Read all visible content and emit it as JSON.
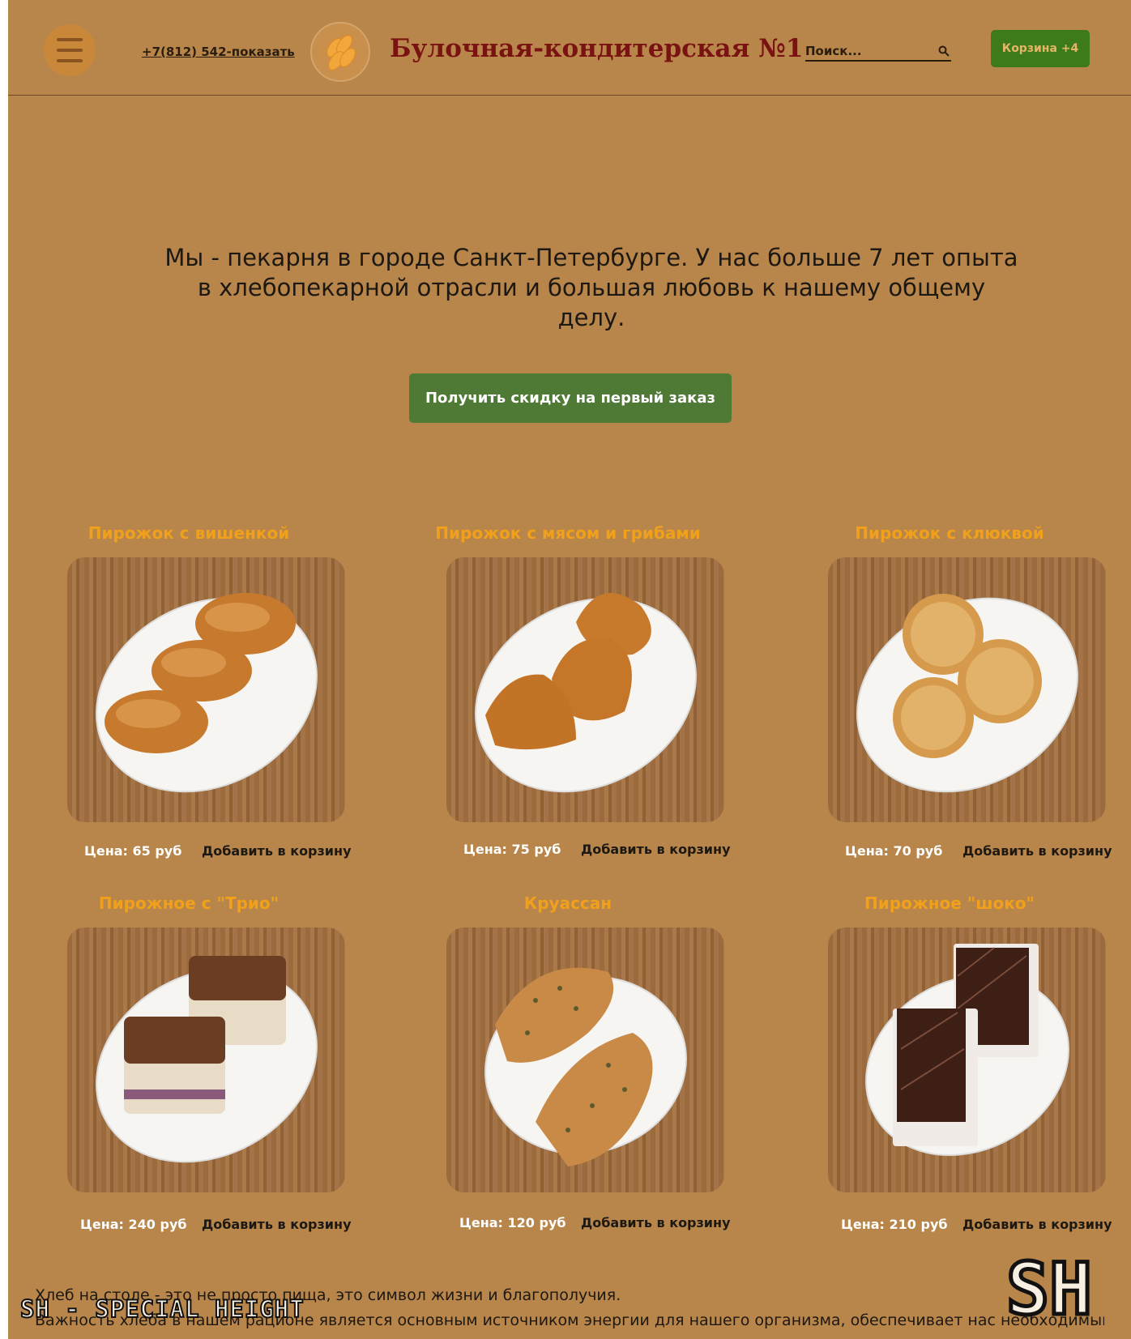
{
  "header": {
    "menu_icon": "hamburger-icon",
    "phone": "+7(812) 542-показать",
    "logo_icon": "wheat-logo",
    "title": "Булочная-кондитерская №1",
    "search_placeholder": "Поиск...",
    "search_icon": "search-icon",
    "cart_label": "Корзина +4"
  },
  "hero": {
    "line1": "Мы - пекарня в городе Санкт-Петербурге.  У нас больше 7 лет опыта",
    "line2": "в хлебопекарной отрасли и большая любовь к нашему общему",
    "line3": "делу.",
    "cta_label": "Получить скидку на первый заказ"
  },
  "products": [
    {
      "name": "Пирожок с  вишенкой",
      "price": "Цена: 65 руб",
      "add_label": "Добавить в корзину"
    },
    {
      "name": "Пирожок с мясом и грибами",
      "price": "Цена: 75 руб",
      "add_label": "Добавить в корзину"
    },
    {
      "name": "Пирожок с клюквой",
      "price": "Цена: 70 руб",
      "add_label": "Добавить в корзину"
    },
    {
      "name": "Пирожное с \"Трио\"",
      "price": "Цена: 240 руб",
      "add_label": "Добавить в корзину"
    },
    {
      "name": "Круассан",
      "price": "Цена: 120 руб",
      "add_label": "Добавить в корзину"
    },
    {
      "name": "Пирожное \"шоко\"",
      "price": "Цена: 210 руб",
      "add_label": "Добавить в корзину"
    }
  ],
  "about": {
    "line1": "Хлеб на столе - это не просто пища, это символ жизни и благополучия.",
    "line2": "Важность хлеба в нашем рационе является основным источником энергии для нашего организма, обеспечивает нас необходимыми"
  },
  "watermark": {
    "text": "SH - SPECIAL HEIGHT",
    "logo_text": "SH"
  },
  "colors": {
    "page_background": "#b8864b",
    "title": "#7a1212",
    "product_name": "#f0a01a",
    "cart_button": "#3d7a1a",
    "cta_button": "#4f7a36"
  }
}
